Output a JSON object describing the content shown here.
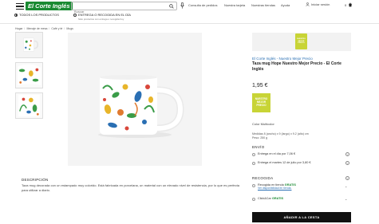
{
  "header": {
    "logo_text": "El Corte Inglés",
    "search_placeholder": "Buscar",
    "nav": [
      "Consulta de pedidos",
      "Nuestra tarjeta",
      "Nuestras tiendas",
      "Ayuda"
    ],
    "login_label": "Iniciar sesión",
    "cart_count": "0"
  },
  "delivery_filter": {
    "all_label": "TODOS LOS PRODUCTOS",
    "store_label": "ENTREGA O RECOGIDA EN EL DÍA",
    "store_sub": "Sólo productos con entrega o recogida hoy"
  },
  "breadcrumb": [
    "Hogar",
    "Menaje de mesa",
    "Café y té",
    "Mugs"
  ],
  "product": {
    "brand_line": "El Corte Inglés - Nuestro Mejor Precio",
    "title": "Taza mug Hope Nuestro Mejor Precio - El Corte Inglés",
    "price": "1,95 €",
    "badge_lines": [
      "NUESTRO",
      "MEJOR",
      "PRECIO"
    ],
    "color": "Color Multicolor",
    "measures": [
      "Medidas 8 (ancho) x 9 (largo) x 9.2 (alto) cm",
      "Peso: 250 g"
    ]
  },
  "shipping": {
    "title": "ENVÍO",
    "options": [
      "Entrega en el día por 7,06 €",
      "Entrega el martes 12 de julio por 3,80 €"
    ]
  },
  "pickup": {
    "title": "RECOGIDA",
    "store_option": "Recogida en tienda",
    "store_free": "GRATIS",
    "store_link": "Ver disponibilidad en tienda.",
    "click_option": "Click&Car",
    "click_free": "GRATIS"
  },
  "add_to_cart_label": "AÑADIR A LA CESTA",
  "description": {
    "title": "DESCRIPCIÓN",
    "text": "Taza mug decorada con un estampado muy colorido. Está fabricada en porcelana, un material con un elevado nivel de resistencia, por lo que es perfecta para utilizar a diario."
  },
  "colors": {
    "brand_green": "#1a8a32",
    "badge_green": "#c8d436",
    "link_blue": "#2a6fb3",
    "button_black": "#111111"
  }
}
